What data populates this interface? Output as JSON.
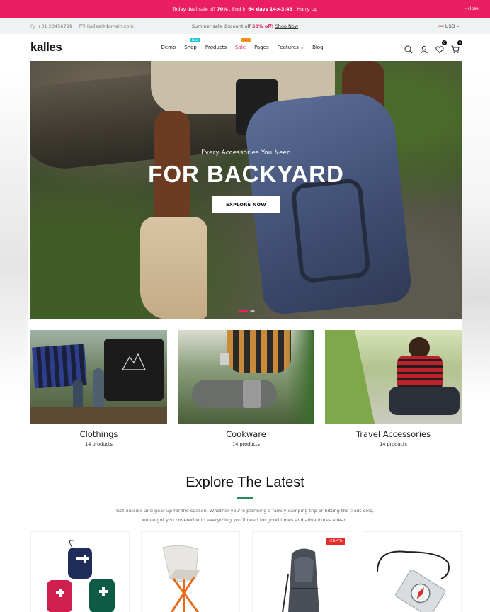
{
  "promo": {
    "text1": "Today deal sale off",
    "percent": "70%",
    "text2": ". End in",
    "countdown": "64 days 14:43:43",
    "text3": ". Hurry Up",
    "close": "close"
  },
  "infobar": {
    "phone": "+01 23456789",
    "email": "Kalles@domain.com",
    "summer_text": "Summer sale discount off",
    "summer_percent": "50% off!",
    "shop_now": "Shop Now",
    "currency": "USD"
  },
  "header": {
    "logo": "kalles",
    "nav": {
      "demo": "Demo",
      "shop": "Shop",
      "shop_badge": "New",
      "products": "Products",
      "sale": "Sale",
      "sale_badge": "Sale",
      "pages": "Pages",
      "features": "Features",
      "blog": "Blog"
    },
    "wishlist_count": "0",
    "cart_count": "0"
  },
  "hero": {
    "subtitle": "Every Accessories You Need",
    "title": "FOR BACKYARD",
    "button": "EXPLORE NOW"
  },
  "categories": [
    {
      "name": "Clothings",
      "count": "14 products"
    },
    {
      "name": "Cookware",
      "count": "14 products"
    },
    {
      "name": "Travel Accessories",
      "count": "14 products"
    }
  ],
  "explore": {
    "title": "Explore The Latest",
    "line1": "Get outside and gear up for the season. Whether you're planning a family camping trip or hitting the trails solo,",
    "line2": "we've got you covered with everything you'll need for good times and adventures ahead."
  },
  "products": [
    {
      "tag": ""
    },
    {
      "tag": ""
    },
    {
      "tag": "-28.4%"
    },
    {
      "tag": ""
    }
  ],
  "colors": {
    "accent": "#e91e63",
    "infobar_bg": "#eef2f2"
  }
}
